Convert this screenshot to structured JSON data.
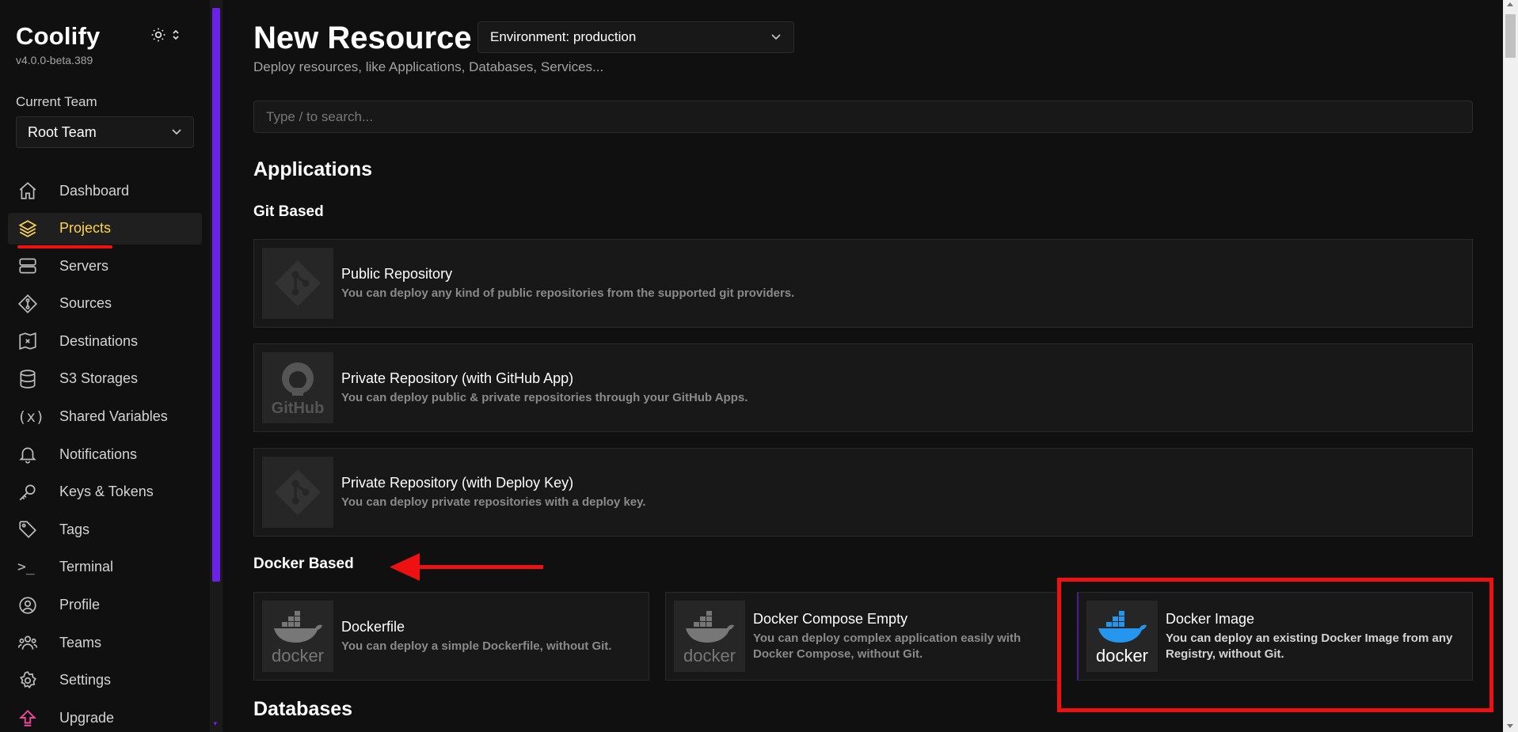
{
  "app": {
    "name": "Coolify",
    "version": "v4.0.0-beta.389"
  },
  "team": {
    "label": "Current Team",
    "selected": "Root Team"
  },
  "nav": [
    {
      "label": "Dashboard",
      "icon": "home-icon"
    },
    {
      "label": "Projects",
      "icon": "layers-icon",
      "active": true
    },
    {
      "label": "Servers",
      "icon": "server-icon"
    },
    {
      "label": "Sources",
      "icon": "git-icon"
    },
    {
      "label": "Destinations",
      "icon": "destination-icon"
    },
    {
      "label": "S3 Storages",
      "icon": "database-icon"
    },
    {
      "label": "Shared Variables",
      "icon": "variable-icon",
      "glyph": "(x)"
    },
    {
      "label": "Notifications",
      "icon": "bell-icon"
    },
    {
      "label": "Keys & Tokens",
      "icon": "key-icon"
    },
    {
      "label": "Tags",
      "icon": "tag-icon"
    },
    {
      "label": "Terminal",
      "icon": "terminal-icon",
      "glyph": ">_"
    },
    {
      "label": "Profile",
      "icon": "user-icon"
    },
    {
      "label": "Teams",
      "icon": "users-icon"
    },
    {
      "label": "Settings",
      "icon": "gear-icon"
    },
    {
      "label": "Upgrade",
      "icon": "upgrade-icon"
    }
  ],
  "page": {
    "title": "New Resource",
    "environment": "Environment: production",
    "subtitle": "Deploy resources, like Applications, Databases, Services...",
    "search_placeholder": "Type / to search..."
  },
  "sections": {
    "applications": "Applications",
    "git_based": "Git Based",
    "docker_based": "Docker Based",
    "databases": "Databases"
  },
  "git_cards": [
    {
      "title": "Public Repository",
      "desc": "You can deploy any kind of public repositories from the supported git providers.",
      "logo": "git-logo"
    },
    {
      "title": "Private Repository (with GitHub App)",
      "desc": "You can deploy public & private repositories through your GitHub Apps.",
      "logo": "github-logo"
    },
    {
      "title": "Private Repository (with Deploy Key)",
      "desc": "You can deploy private repositories with a deploy key.",
      "logo": "git-logo"
    }
  ],
  "docker_cards": [
    {
      "title": "Dockerfile",
      "desc": "You can deploy a simple Dockerfile, without Git.",
      "logo_text": "docker"
    },
    {
      "title": "Docker Compose Empty",
      "desc": "You can deploy complex application easily with Docker Compose, without Git.",
      "logo_text": "docker"
    },
    {
      "title": "Docker Image",
      "desc": "You can deploy an existing Docker Image from any Registry, without Git.",
      "logo_text": "docker"
    }
  ],
  "colors": {
    "accent": "#fcd452",
    "scroll": "#6b21e8",
    "annotation": "#ee1111",
    "docker_blue": "#2496ed"
  }
}
